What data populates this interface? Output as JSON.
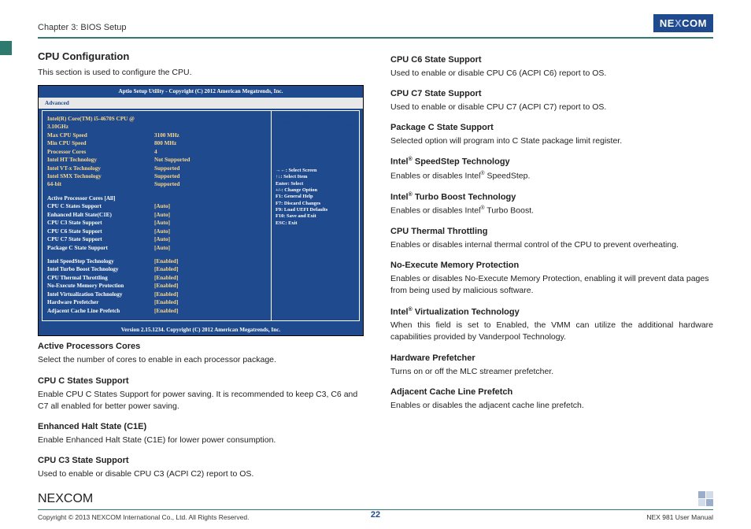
{
  "header": {
    "chapter": "Chapter 3: BIOS Setup",
    "logo_left": "NE",
    "logo_x": "X",
    "logo_right": "COM"
  },
  "page_number": "22",
  "footer": {
    "copyright": "Copyright © 2013 NEXCOM International Co., Ltd. All Rights Reserved.",
    "doc": "NEX 981 User Manual"
  },
  "left": {
    "title": "CPU Configuration",
    "intro": "This section is used to configure the CPU.",
    "items": [
      {
        "h": "Active Processors Cores",
        "b": "Select the number of cores to enable in each processor package."
      },
      {
        "h": "CPU C States Support",
        "b": "Enable CPU C States Support for power saving. It is recommended to keep C3, C6 and C7 all enabled for better power saving."
      },
      {
        "h": "Enhanced Halt State (C1E)",
        "b": "Enable Enhanced Halt State (C1E) for lower power consumption."
      },
      {
        "h": "CPU C3 State Support",
        "b": "Used to enable or disable CPU C3 (ACPI C2) report to OS."
      }
    ]
  },
  "right": {
    "items": [
      {
        "h": "CPU C6 State Support",
        "b": "Used to enable or disable CPU C6 (ACPI C6) report to OS."
      },
      {
        "h": "CPU C7 State Support",
        "b": "Used to enable or disable CPU C7 (ACPI C7) report to OS."
      },
      {
        "h": "Package C State Support",
        "b": "Selected option will program into C State package limit register."
      },
      {
        "h": "Intel® SpeedStep Technology",
        "b": "Enables or disables Intel® SpeedStep."
      },
      {
        "h": "Intel® Turbo Boost Technology",
        "b": "Enables or disables Intel® Turbo Boost."
      },
      {
        "h": "CPU Thermal Throttling",
        "b": "Enables or disables internal thermal control of the CPU to prevent overheating.",
        "justify": true
      },
      {
        "h": "No-Execute Memory Protection",
        "b": "Enables or disables No-Execute Memory Protection, enabling it will prevent data pages from being used by malicious software."
      },
      {
        "h": "Intel® Virtualization Technology",
        "b": "When this field is set to Enabled, the VMM can utilize the additional hardware capabilities provided by Vanderpool Technology.",
        "justify": true
      },
      {
        "h": "Hardware Prefetcher",
        "b": "Turns on or off the MLC streamer prefetcher."
      },
      {
        "h": "Adjacent Cache Line Prefetch",
        "b": "Enables or disables the adjacent cache line prefetch."
      }
    ]
  },
  "bios": {
    "title": "Aptio Setup Utility - Copyright (C) 2012 American Megatrends, Inc.",
    "tab": "Advanced",
    "footer": "Version 2.15.1234. Copyright (C) 2012 American Megatrends, Inc.",
    "help": "Select the number of cores to enable in each processor package.",
    "info": [
      {
        "l": "Intel(R) Core(TM) i5-4670S CPU @ 3.10GHz",
        "v": ""
      },
      {
        "l": "Max CPU Speed",
        "v": "3100 MHz"
      },
      {
        "l": "Min CPU Speed",
        "v": "800 MHz"
      },
      {
        "l": "Processor Cores",
        "v": "4"
      },
      {
        "l": "Intel HT Technology",
        "v": "Not Supported"
      },
      {
        "l": "Intel VT-x Technology",
        "v": "Supported"
      },
      {
        "l": "Intel SMX Technology",
        "v": "Supported"
      },
      {
        "l": "64-bit",
        "v": "Supported"
      }
    ],
    "head": {
      "l": "Active Processor Cores",
      "v": "[All]"
    },
    "opts": [
      {
        "l": "CPU C States Support",
        "v": "[Auto]"
      },
      {
        "l": "Enhanced Halt State(C1E)",
        "v": "[Auto]"
      },
      {
        "l": "CPU C3 State Support",
        "v": "[Auto]"
      },
      {
        "l": "CPU C6 State Support",
        "v": "[Auto]"
      },
      {
        "l": "CPU C7 State Support",
        "v": "[Auto]"
      },
      {
        "l": "Package C State Support",
        "v": "[Auto]"
      }
    ],
    "en": [
      {
        "l": "Intel SpeedStep Technology",
        "v": "[Enabled]"
      },
      {
        "l": "Intel Turbo Boost Technology",
        "v": "[Enabled]"
      },
      {
        "l": "CPU Thermal Throttling",
        "v": "[Enabled]"
      },
      {
        "l": "No-Execute Memory Protection",
        "v": "[Enabled]"
      },
      {
        "l": "Intel Virtualization Technology",
        "v": "[Enabled]"
      },
      {
        "l": "Hardware Prefetcher",
        "v": "[Enabled]"
      },
      {
        "l": "Adjacent Cache Line Prefetch",
        "v": "[Enabled]"
      }
    ],
    "hints": [
      "→←: Select Screen",
      "↑↓: Select Item",
      "Enter: Select",
      "+/-: Change Option",
      "F1: General Help",
      "F7: Discard Changes",
      "F9: Load UEFI Defaults",
      "F10: Save and Exit",
      "ESC: Exit"
    ]
  }
}
